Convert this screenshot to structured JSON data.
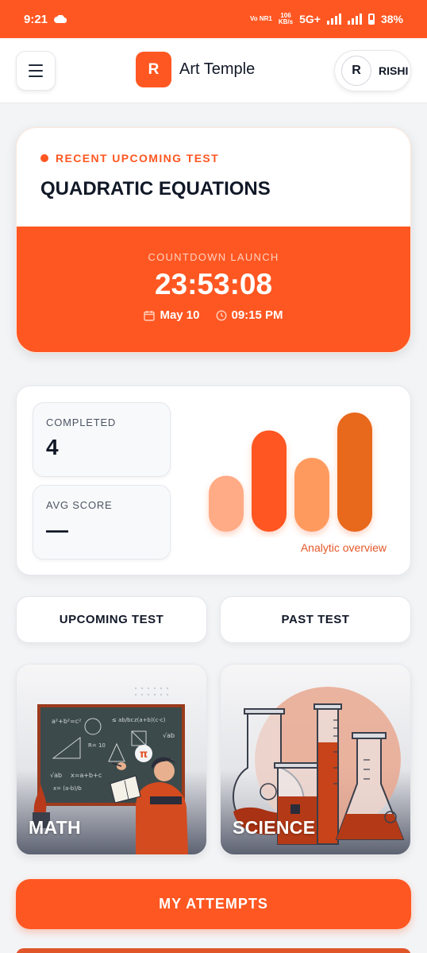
{
  "status_bar": {
    "time": "9:21",
    "net_type": "Vo NR1",
    "speed_value": "106",
    "speed_unit": "KB/s",
    "network": "5G+",
    "battery": "38%"
  },
  "header": {
    "brand_initial": "R",
    "brand_name": "Art Temple",
    "user_initial": "R",
    "user_name": "RISHI"
  },
  "test_card": {
    "label": "RECENT UPCOMING TEST",
    "title": "QUADRATIC EQUATIONS",
    "countdown_label": "COUNTDOWN LAUNCH",
    "countdown_time": "23:53:08",
    "date": "May 10",
    "time": "09:15 PM"
  },
  "stats": {
    "completed_label": "COMPLETED",
    "completed_value": "4",
    "avg_label": "AVG SCORE",
    "avg_value": "—",
    "analytic_label": "Analytic overview"
  },
  "chart_data": {
    "type": "bar",
    "values": [
      0.47,
      0.85,
      0.62,
      1.0
    ],
    "colors": [
      "#ffab85",
      "#ff5722",
      "#ff9a5f",
      "#e8671f"
    ]
  },
  "tabs": {
    "upcoming": "UPCOMING TEST",
    "past": "PAST TEST"
  },
  "subjects": {
    "math": "MATH",
    "science": "SCIENCE"
  },
  "attempts_button": "MY ATTEMPTS",
  "colors": {
    "accent": "#ff5722"
  }
}
